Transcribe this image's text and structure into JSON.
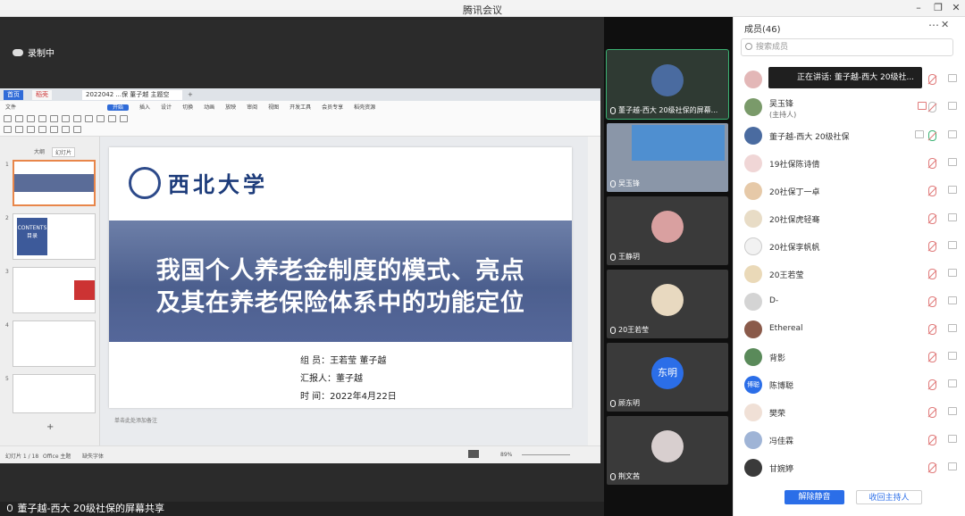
{
  "window": {
    "title": "腾讯会议"
  },
  "stage": {
    "recording": "录制中",
    "share_label": "董子越-西大 20级社保的屏幕共享"
  },
  "wps": {
    "tabs": [
      "首页",
      "稻壳",
      "2022042 ...保 董子越 主题空"
    ],
    "menus": [
      "文件",
      "开始",
      "插入",
      "设计",
      "切换",
      "动画",
      "放映",
      "审阅",
      "视图",
      "开发工具",
      "会员专享",
      "稻壳资源"
    ],
    "side_tabs": [
      "大纲",
      "幻灯片"
    ],
    "thumb_numbers": [
      "1",
      "2",
      "3",
      "4",
      "5"
    ],
    "thumb2_text": "CONTENTS 目录",
    "slide": {
      "university": "西北大学",
      "title_line1": "我国个人养老金制度的模式、亮点",
      "title_line2": "及其在养老保险体系中的功能定位",
      "members": "组    员：王若莹  董子越",
      "reporter": "汇报人：董子越",
      "date": "时    间：2022年4月22日"
    },
    "notes_placeholder": "单击此处添加备注",
    "status_left": "幻灯片 1 / 18",
    "status_theme": "Office 主题",
    "status_fix": "缺失字体",
    "status_zoom": "89%"
  },
  "videos": [
    {
      "name": "董子越-西大 20级社保的屏幕..."
    },
    {
      "name": "吴玉锋"
    },
    {
      "name": "王静玥"
    },
    {
      "name": "20王若莹"
    },
    {
      "name": "顾东明",
      "avatar_text": "东明"
    },
    {
      "name": "荆文茜"
    }
  ],
  "panel": {
    "title": "成员(46)",
    "search_placeholder": "搜索成员",
    "speaking_now": "正在讲话: 董子越-西大 20级社...",
    "members": [
      {
        "name": ""
      },
      {
        "name": "吴玉锋",
        "sub": "(主持人)"
      },
      {
        "name": "董子越-西大 20级社保"
      },
      {
        "name": "19社保陈诗倩"
      },
      {
        "name": "20社保丁一卓"
      },
      {
        "name": "20社保虎轻骞"
      },
      {
        "name": "20社保李帆帆"
      },
      {
        "name": "20王若莹"
      },
      {
        "name": "D-"
      },
      {
        "name": "Ethereal"
      },
      {
        "name": "背影"
      },
      {
        "name": "陈博聪",
        "avatar_text": "博聪"
      },
      {
        "name": "樊荣"
      },
      {
        "name": "冯佳霖"
      },
      {
        "name": "甘婉婷"
      }
    ],
    "unmute_all": "解除静音",
    "reclaim_host": "收回主持人"
  },
  "colors": {
    "accent": "#2b6ee8",
    "slide_banner": "#4c5f8e",
    "active_tile": "#3bb273"
  }
}
